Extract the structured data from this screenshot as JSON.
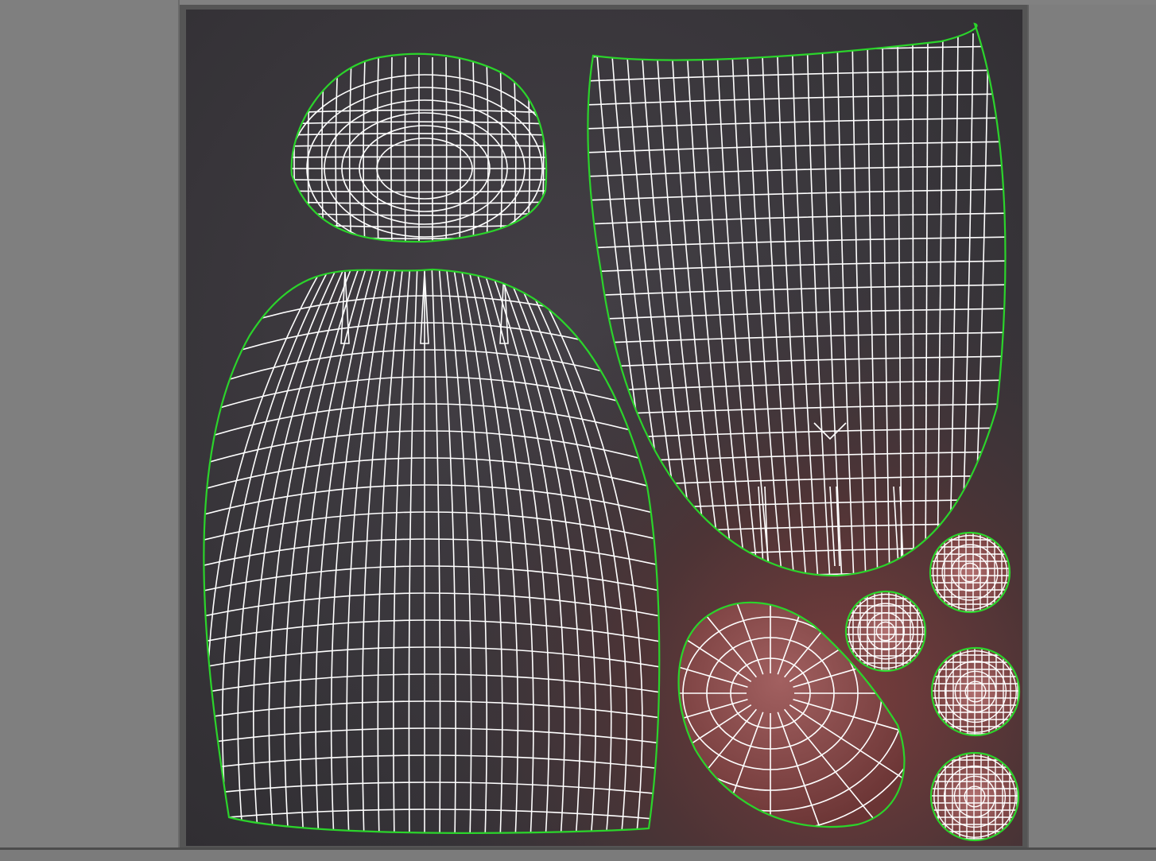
{
  "colors": {
    "background": "#7d7d7d",
    "uv_bg_dark": "#39363a",
    "uv_bg_red": "#6e3a3a",
    "wire": "#ffffff",
    "border": "#2bd42b"
  },
  "viewport": {
    "kind": "uv-editor",
    "islands": [
      {
        "name": "uv-island-small-dome"
      },
      {
        "name": "uv-island-large-dome"
      },
      {
        "name": "uv-island-tall-panel"
      },
      {
        "name": "uv-island-pad"
      },
      {
        "name": "uv-island-disc-1"
      },
      {
        "name": "uv-island-disc-2"
      },
      {
        "name": "uv-island-disc-3"
      },
      {
        "name": "uv-island-disc-4"
      }
    ]
  }
}
